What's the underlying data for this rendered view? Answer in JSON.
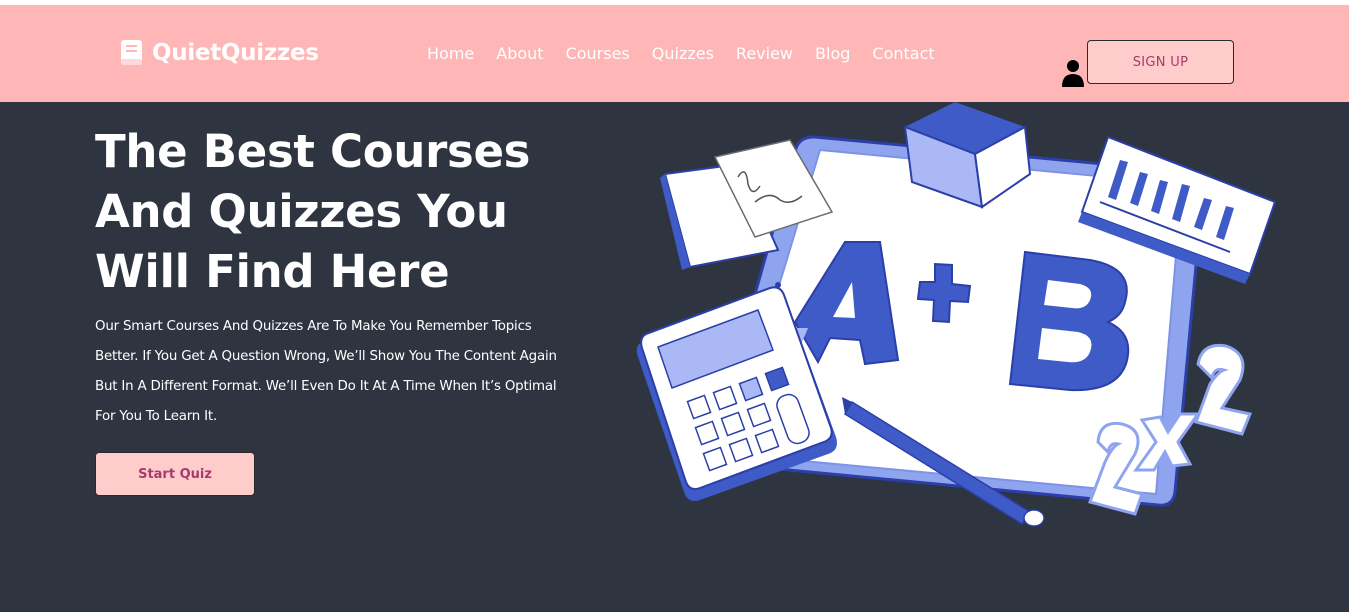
{
  "brand": {
    "name": "QuietQuizzes",
    "icon": "book-icon"
  },
  "nav": {
    "items": [
      {
        "label": "Home"
      },
      {
        "label": "About"
      },
      {
        "label": "Courses"
      },
      {
        "label": "Quizzes"
      },
      {
        "label": "Review"
      },
      {
        "label": "Blog"
      },
      {
        "label": "Contact"
      }
    ],
    "user_icon": "user-icon",
    "signup_label": "SIGN UP"
  },
  "hero": {
    "title_lines": [
      "The Best Courses",
      "And Quizzes You",
      "Will Find Here"
    ],
    "description_lines": [
      "Our Smart Courses And Quizzes Are To Make You Remember Topics",
      "Better. If You Get A Question Wrong, We’ll Show You The Content Again",
      "But In A Different Format. We’ll Even Do It At A Time When It’s Optimal",
      "For You To Learn It."
    ],
    "button_label": "Start Quiz"
  },
  "illustration": {
    "board_text": "A+B",
    "math_text": "2x2"
  },
  "colors": {
    "navbar": "#ffb6b6",
    "background": "#2e3440",
    "button_bg": "#ffcccc",
    "button_text": "#a83a6e",
    "accent_blue": "#3e5bc7",
    "light_blue": "#aab8f5"
  }
}
